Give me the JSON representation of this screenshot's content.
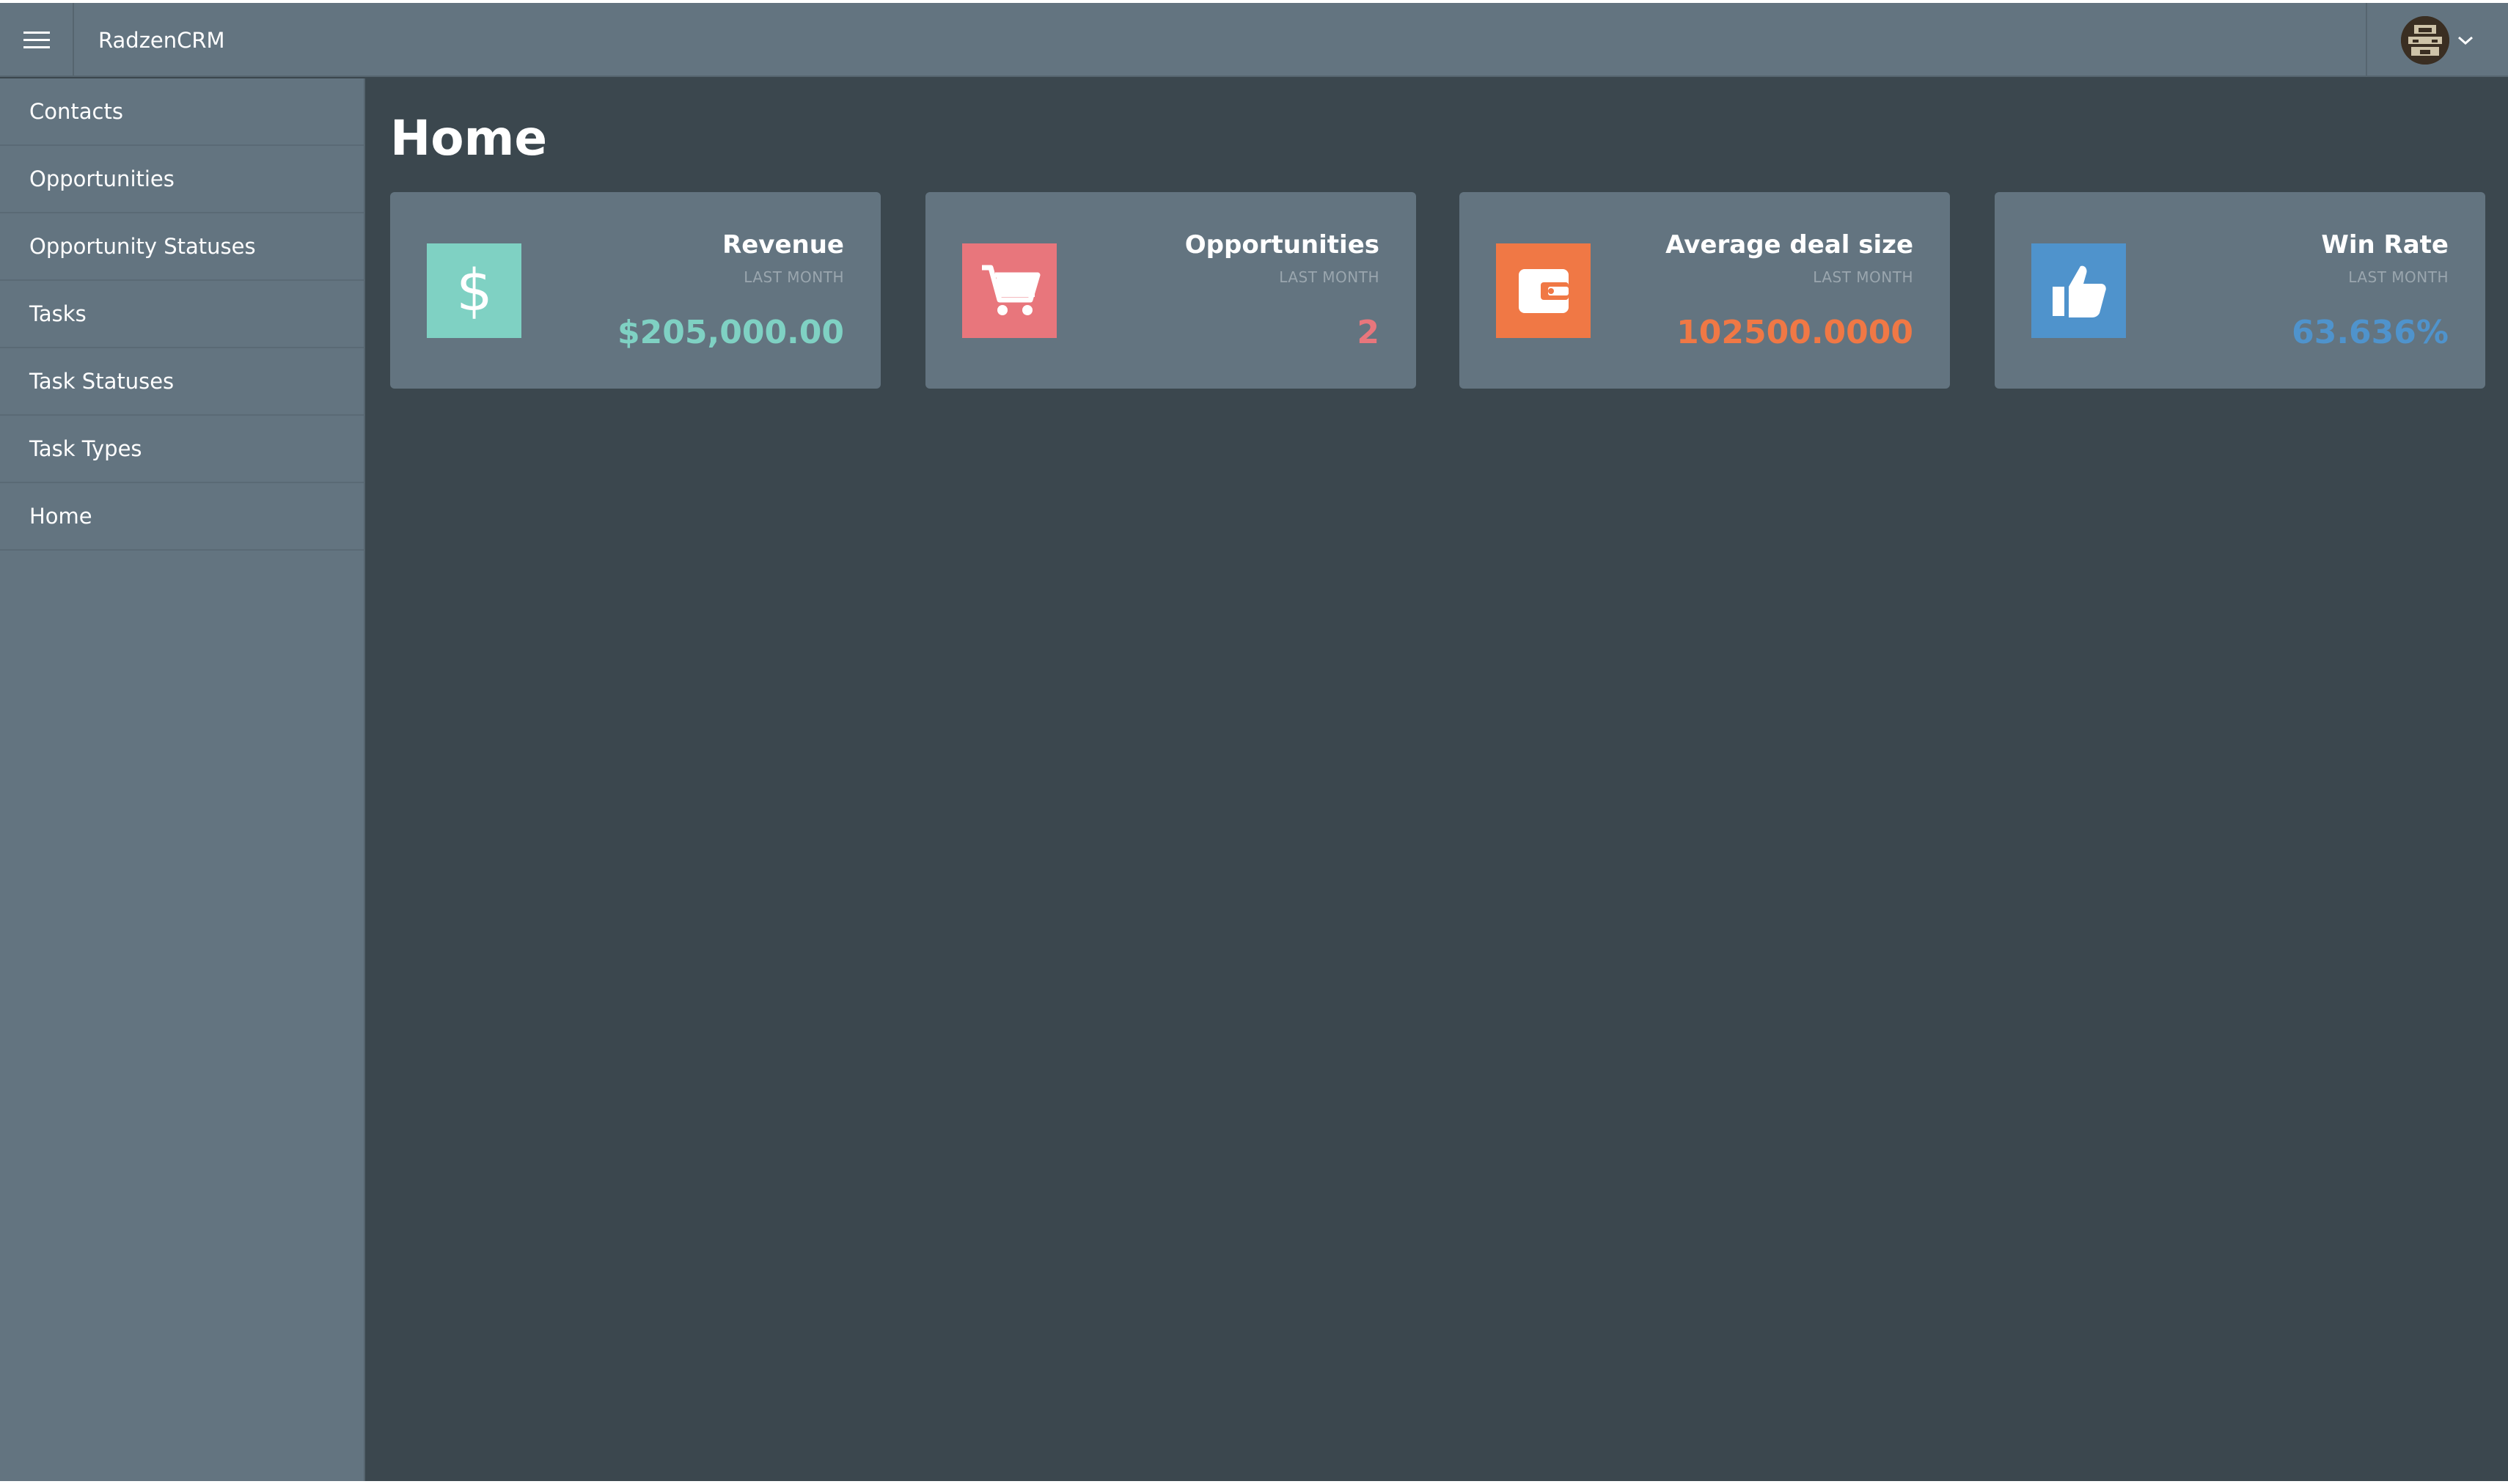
{
  "header": {
    "brand": "RadzenCRM",
    "menu_icon": "hamburger-menu-icon",
    "profile_icon": "avatar",
    "profile_chevron_icon": "chevron-down-icon"
  },
  "sidebar": {
    "items": [
      {
        "label": "Contacts"
      },
      {
        "label": "Opportunities"
      },
      {
        "label": "Opportunity Statuses"
      },
      {
        "label": "Tasks"
      },
      {
        "label": "Task Statuses"
      },
      {
        "label": "Task Types"
      },
      {
        "label": "Home"
      }
    ]
  },
  "main": {
    "title": "Home",
    "cards": [
      {
        "title": "Revenue",
        "subtitle": "LAST MONTH",
        "value": "$205,000.00",
        "icon": "dollar-icon",
        "color": "#7fd1c3"
      },
      {
        "title": "Opportunities",
        "subtitle": "LAST MONTH",
        "value": "2",
        "icon": "shopping-cart-icon",
        "color": "#e8767c"
      },
      {
        "title": "Average deal size",
        "subtitle": "LAST MONTH",
        "value": "102500.0000",
        "icon": "wallet-icon",
        "color": "#f07845"
      },
      {
        "title": "Win Rate",
        "subtitle": "LAST MONTH",
        "value": "63.636%",
        "icon": "thumbs-up-icon",
        "color": "#4f93cc"
      }
    ]
  },
  "colors": {
    "header_bg": "#637480",
    "sidebar_bg": "#637480",
    "content_bg": "#3b474e",
    "card_bg": "#637480"
  }
}
